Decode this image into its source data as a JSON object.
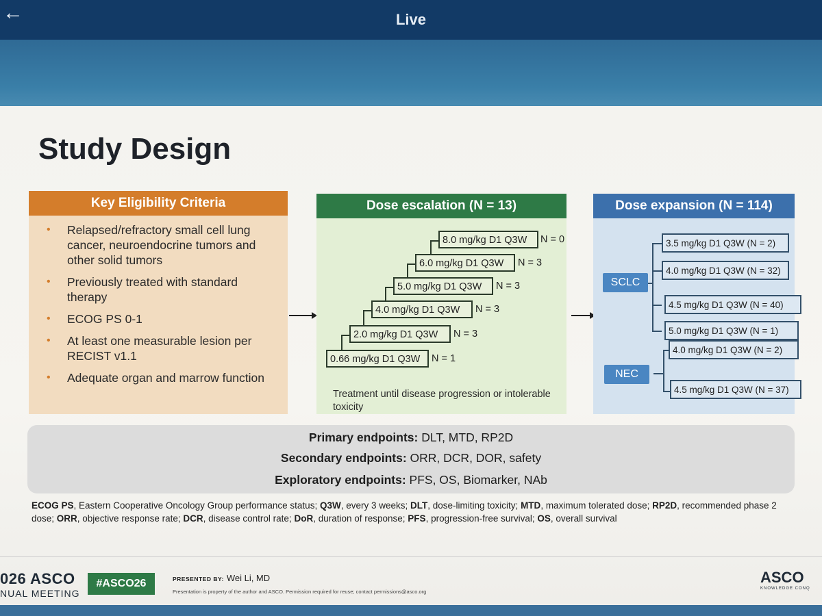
{
  "app": {
    "title": "Live",
    "back_icon": "arrow-left-icon"
  },
  "slide": {
    "title": "Study Design",
    "eligibility": {
      "header": "Key Eligibility Criteria",
      "items": [
        "Relapsed/refractory small cell lung cancer, neuroendocrine tumors and other solid tumors",
        "Previously treated with standard therapy",
        "ECOG PS 0-1",
        "At least one measurable lesion per RECIST v1.1",
        "Adequate organ and marrow function"
      ]
    },
    "escalation": {
      "header": "Dose escalation (N = 13)",
      "doses": [
        {
          "dose": "0.66 mg/kg D1 Q3W",
          "n": "N = 1"
        },
        {
          "dose": "2.0 mg/kg D1 Q3W",
          "n": "N = 3"
        },
        {
          "dose": "4.0 mg/kg D1 Q3W",
          "n": "N = 3"
        },
        {
          "dose": "5.0 mg/kg D1 Q3W",
          "n": "N = 3"
        },
        {
          "dose": "6.0 mg/kg D1 Q3W",
          "n": "N = 3"
        },
        {
          "dose": "8.0 mg/kg D1 Q3W",
          "n": "N = 0"
        }
      ],
      "note": "Treatment until disease progression or intolerable toxicity"
    },
    "expansion": {
      "header": "Dose expansion (N = 114)",
      "arms": [
        {
          "label": "SCLC",
          "doses": [
            "3.5 mg/kg D1 Q3W (N = 2)",
            "4.0 mg/kg D1 Q3W (N = 32)",
            "4.5 mg/kg D1 Q3W (N = 40)",
            "5.0 mg/kg D1 Q3W (N = 1)"
          ]
        },
        {
          "label": "NEC",
          "doses": [
            "4.0 mg/kg D1 Q3W (N = 2)",
            "4.5 mg/kg D1 Q3W (N = 37)"
          ]
        }
      ]
    },
    "endpoints": {
      "primary_label": "Primary endpoints:",
      "primary": "DLT, MTD, RP2D",
      "secondary_label": "Secondary endpoints:",
      "secondary": "ORR, DCR, DOR, safety",
      "exploratory_label": "Exploratory endpoints:",
      "exploratory": "PFS, OS, Biomarker, NAb"
    },
    "abbreviations": [
      {
        "term": "ECOG PS",
        "def": ", Eastern Cooperative Oncology Group performance status; "
      },
      {
        "term": "Q3W",
        "def": ", every 3 weeks; "
      },
      {
        "term": "DLT",
        "def": ", dose-limiting toxicity; "
      },
      {
        "term": "MTD",
        "def": ", maximum tolerated dose; "
      },
      {
        "term": "RP2D",
        "def": ", recommended phase 2 dose; "
      },
      {
        "term": "ORR",
        "def": ", objective response rate; "
      },
      {
        "term": "DCR",
        "def": ", disease control rate; "
      },
      {
        "term": "DoR",
        "def": ", duration of response; "
      },
      {
        "term": "PFS",
        "def": ", progression-free survival; "
      },
      {
        "term": "OS",
        "def": ", overall survival"
      }
    ],
    "footer": {
      "meeting_logo_top": "026 ASCO",
      "meeting_logo_bottom": "NUAL MEETING",
      "hashtag": "#ASCO26",
      "presented_by_label": "PRESENTED BY:",
      "presenter": "Wei Li, MD",
      "note": "Presentation is property of the author and ASCO. Permission required for reuse; contact permissions@asco.org",
      "right_logo": "ASCO",
      "right_logo_sub": "KNOWLEDGE CONQ"
    },
    "colors": {
      "eligibility": "#d47d2b",
      "escalation": "#2e7a46",
      "expansion": "#3c70ac",
      "hashtag": "#2e7a46"
    }
  }
}
